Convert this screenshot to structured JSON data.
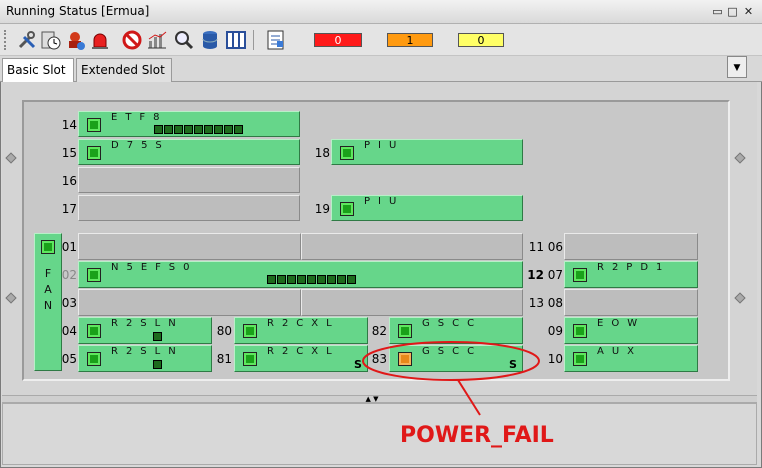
{
  "window": {
    "title": "Running Status [Ermua]",
    "controls": [
      "▭",
      "□",
      "✕"
    ]
  },
  "toolbar": {
    "icons": [
      "tools-icon",
      "clock-icon",
      "alarm-user-icon",
      "siren-icon",
      "no-entry-icon",
      "chart-icon",
      "magnifier-icon",
      "database-icon",
      "columns-icon",
      "report-icon"
    ],
    "alarms": [
      {
        "name": "critical",
        "count": "0",
        "color": "#ff1a1a",
        "text_color": "#ffffff"
      },
      {
        "name": "major",
        "count": "1",
        "color": "#ff9a10",
        "text_color": "#000000"
      },
      {
        "name": "minor",
        "count": "0",
        "color": "#ffff66",
        "text_color": "#000000"
      }
    ]
  },
  "tabs": [
    {
      "label": "Basic Slot",
      "selected": true
    },
    {
      "label": "Extended Slot",
      "selected": false
    }
  ],
  "fan": {
    "label": [
      "F",
      "A",
      "N"
    ]
  },
  "slots": {
    "s14": {
      "num": "14",
      "board": "ETF8",
      "ports": 9
    },
    "s15": {
      "num": "15",
      "board": "D75S"
    },
    "s16": {
      "num": "16"
    },
    "s17": {
      "num": "17"
    },
    "s18": {
      "num": "18",
      "board": "PIU"
    },
    "s19": {
      "num": "19",
      "board": "PIU"
    },
    "s01": {
      "num": "01"
    },
    "s02": {
      "num": "02",
      "board": "N5EFS0",
      "ports": 9
    },
    "s03": {
      "num": "03"
    },
    "s04": {
      "num": "04",
      "board": "R2SLN"
    },
    "s05": {
      "num": "05",
      "board": "R2SLN"
    },
    "s80": {
      "num": "80",
      "board": "R2CXL"
    },
    "s81": {
      "num": "81",
      "board": "R2CXL",
      "flag": "S"
    },
    "s82": {
      "num": "82",
      "board": "GSCC"
    },
    "s83": {
      "num": "83",
      "board": "GSCC",
      "flag": "S",
      "led": "orange"
    },
    "s11": {
      "num": "11"
    },
    "s12": {
      "num": "12"
    },
    "s13": {
      "num": "13"
    },
    "s06": {
      "num": "06"
    },
    "s07": {
      "num": "07",
      "board": "R2PD1"
    },
    "s08": {
      "num": "08"
    },
    "s09": {
      "num": "09",
      "board": "EOW"
    },
    "s10": {
      "num": "10",
      "board": "AUX"
    }
  },
  "annotation": {
    "text": "POWER_FAIL",
    "color": "#e01818"
  }
}
